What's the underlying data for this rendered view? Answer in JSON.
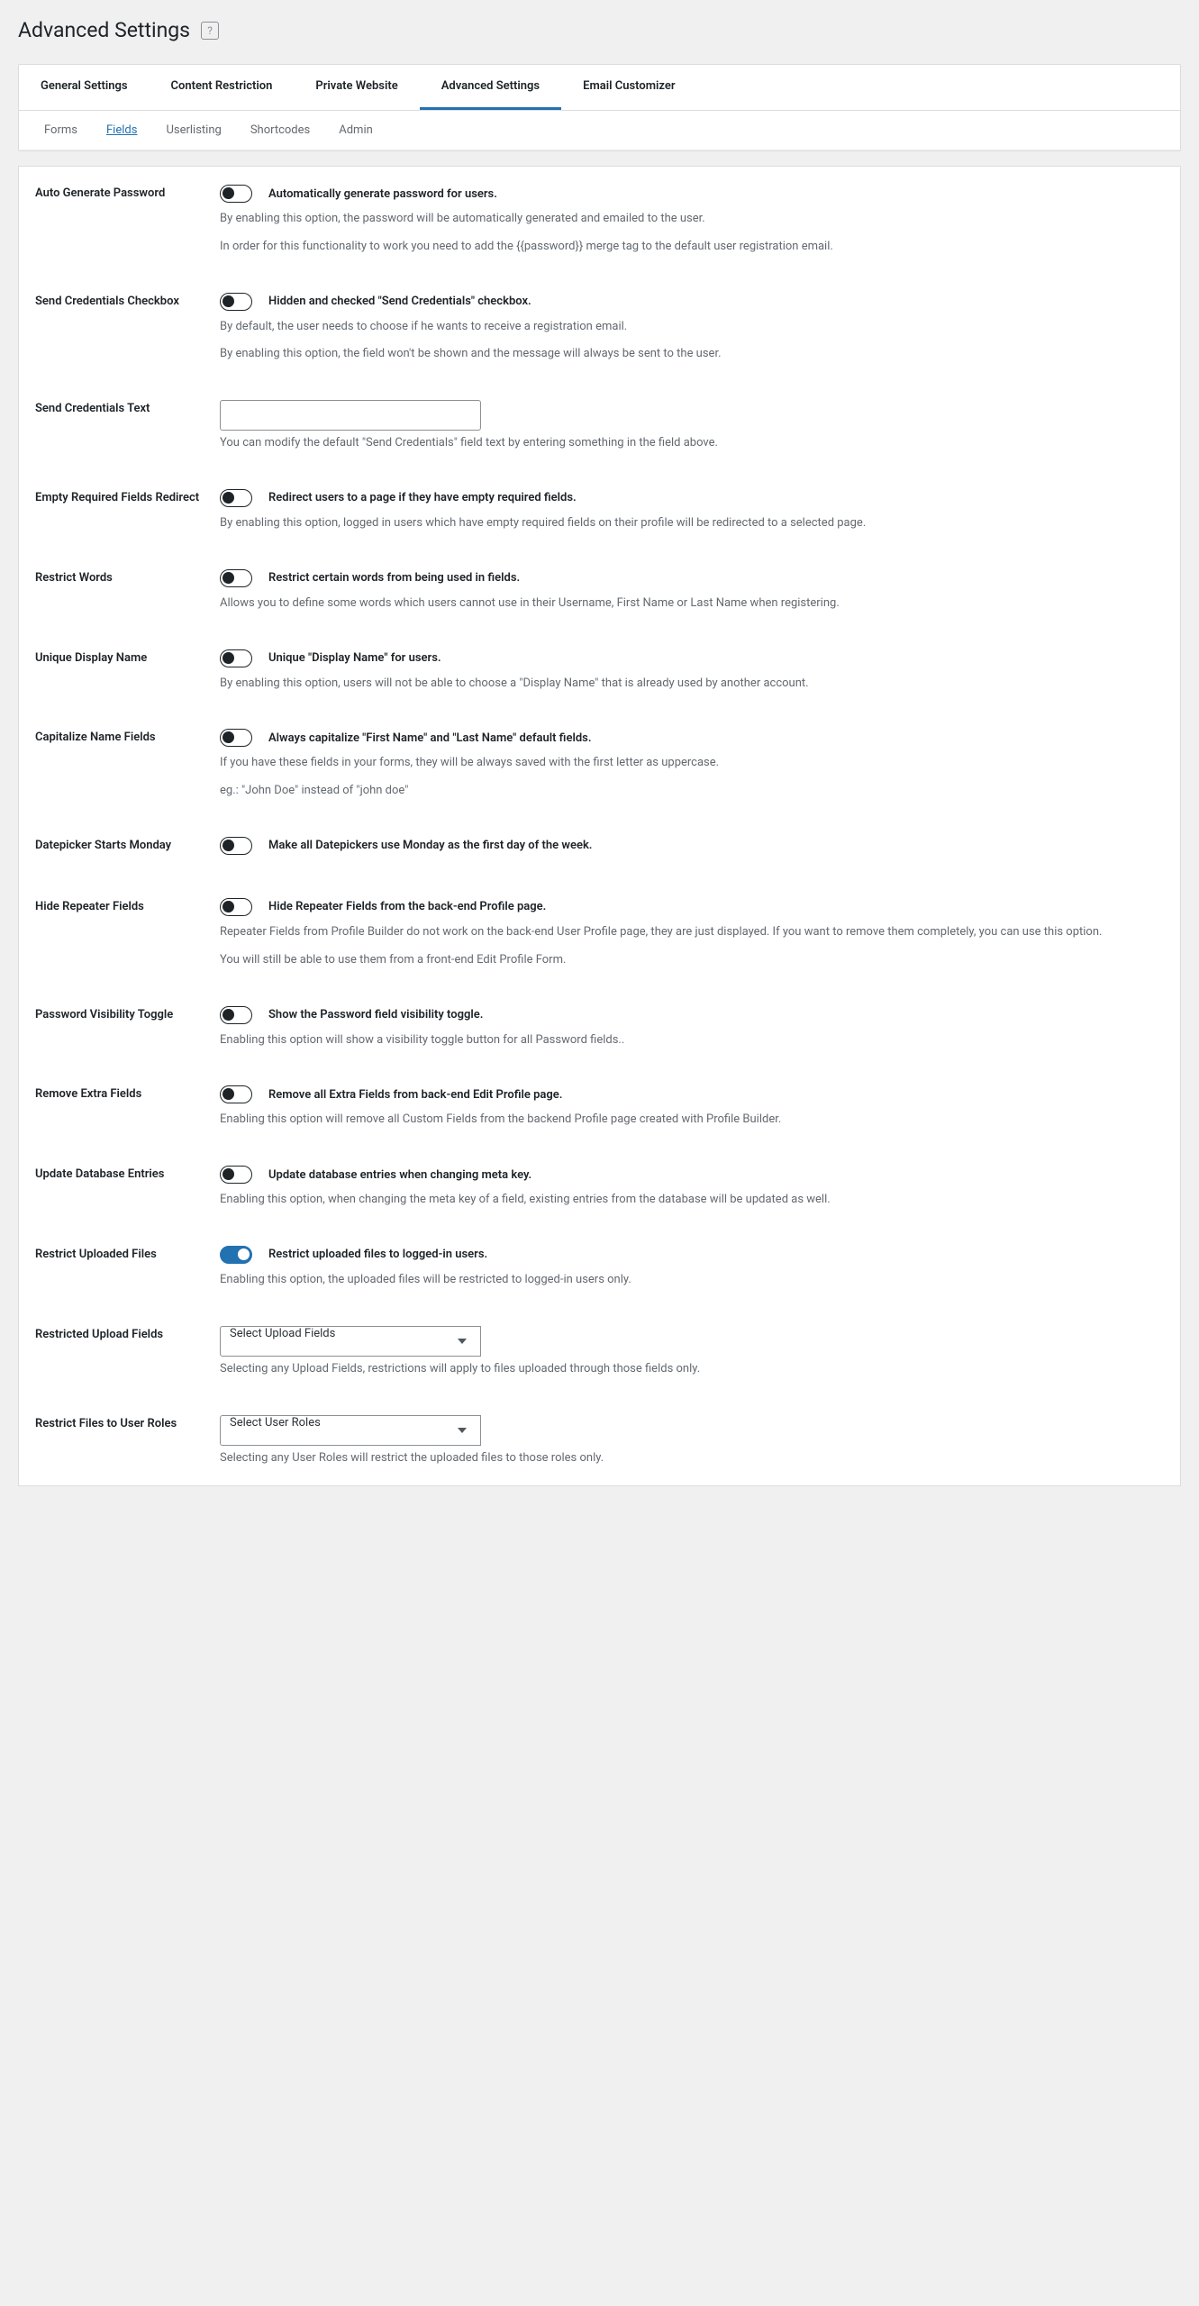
{
  "pageTitle": "Advanced Settings",
  "tabs": [
    "General Settings",
    "Content Restriction",
    "Private Website",
    "Advanced Settings",
    "Email Customizer"
  ],
  "activeTab": 3,
  "subtabs": [
    "Forms",
    "Fields",
    "Userlisting",
    "Shortcodes",
    "Admin"
  ],
  "activeSubtab": 1,
  "rows": [
    {
      "id": "auto-generate-password",
      "label": "Auto Generate Password",
      "control": "toggle",
      "on": false,
      "ctrlLabel": "Automatically generate password for users.",
      "descs": [
        "By enabling this option, the password will be automatically generated and emailed to the user.",
        "In order for this functionality to work you need to add the {{password}} merge tag to the default user registration email."
      ]
    },
    {
      "id": "send-credentials-checkbox",
      "label": "Send Credentials Checkbox",
      "control": "toggle",
      "on": false,
      "ctrlLabel": "Hidden and checked \"Send Credentials\" checkbox.",
      "descs": [
        "By default, the user needs to choose if he wants to receive a registration email.",
        "By enabling this option, the field won't be shown and the message will always be sent to the user."
      ]
    },
    {
      "id": "send-credentials-text",
      "label": "Send Credentials Text",
      "control": "text",
      "value": "",
      "descs": [
        "You can modify the default \"Send Credentials\" field text by entering something in the field above."
      ]
    },
    {
      "id": "empty-required-redirect",
      "label": "Empty Required Fields Redirect",
      "control": "toggle",
      "on": false,
      "ctrlLabel": "Redirect users to a page if they have empty required fields.",
      "descs": [
        "By enabling this option, logged in users which have empty required fields on their profile will be redirected to a selected page."
      ]
    },
    {
      "id": "restrict-words",
      "label": "Restrict Words",
      "control": "toggle",
      "on": false,
      "ctrlLabel": "Restrict certain words from being used in fields.",
      "descs": [
        "Allows you to define some words which users cannot use in their Username, First Name or Last Name when registering."
      ]
    },
    {
      "id": "unique-display-name",
      "label": "Unique Display Name",
      "control": "toggle",
      "on": false,
      "ctrlLabel": "Unique \"Display Name\" for users.",
      "descs": [
        "By enabling this option, users will not be able to choose a \"Display Name\" that is already used by another account."
      ]
    },
    {
      "id": "capitalize-name-fields",
      "label": "Capitalize Name Fields",
      "control": "toggle",
      "on": false,
      "ctrlLabel": "Always capitalize \"First Name\" and \"Last Name\" default fields.",
      "descs": [
        "If you have these fields in your forms, they will be always saved with the first letter as uppercase.",
        "eg.: \"John Doe\" instead of \"john doe\""
      ]
    },
    {
      "id": "datepicker-monday",
      "label": "Datepicker Starts Monday",
      "control": "toggle",
      "on": false,
      "ctrlLabel": "Make all Datepickers use Monday as the first day of the week.",
      "descs": []
    },
    {
      "id": "hide-repeater-fields",
      "label": "Hide Repeater Fields",
      "control": "toggle",
      "on": false,
      "ctrlLabel": "Hide Repeater Fields from the back-end Profile page.",
      "descs": [
        "Repeater Fields from Profile Builder do not work on the back-end User Profile page, they are just displayed. If you want to remove them completely, you can use this option.",
        "You will still be able to use them from a front-end Edit Profile Form."
      ]
    },
    {
      "id": "password-visibility-toggle",
      "label": "Password Visibility Toggle",
      "control": "toggle",
      "on": false,
      "ctrlLabel": "Show the Password field visibility toggle.",
      "descs": [
        "Enabling this option will show a visibility toggle button for all Password fields.."
      ]
    },
    {
      "id": "remove-extra-fields",
      "label": "Remove Extra Fields",
      "control": "toggle",
      "on": false,
      "ctrlLabel": "Remove all Extra Fields from back-end Edit Profile page.",
      "descs": [
        "Enabling this option will remove all Custom Fields from the backend Profile page created with Profile Builder."
      ]
    },
    {
      "id": "update-database-entries",
      "label": "Update Database Entries",
      "control": "toggle",
      "on": false,
      "ctrlLabel": "Update database entries when changing meta key.",
      "descs": [
        "Enabling this option, when changing the meta key of a field, existing entries from the database will be updated as well."
      ]
    },
    {
      "id": "restrict-uploaded-files",
      "label": "Restrict Uploaded Files",
      "control": "toggle",
      "on": true,
      "ctrlLabel": "Restrict uploaded files to logged-in users.",
      "descs": [
        "Enabling this option, the uploaded files will be restricted to logged-in users only."
      ]
    },
    {
      "id": "restricted-upload-fields",
      "label": "Restricted Upload Fields",
      "control": "select",
      "placeholder": "Select Upload Fields",
      "descs": [
        "Selecting any Upload Fields, restrictions will apply to files uploaded through those fields only."
      ]
    },
    {
      "id": "restrict-files-user-roles",
      "label": "Restrict Files to User Roles",
      "control": "select",
      "placeholder": "Select User Roles",
      "descs": [
        "Selecting any User Roles will restrict the uploaded files to those roles only."
      ]
    }
  ]
}
